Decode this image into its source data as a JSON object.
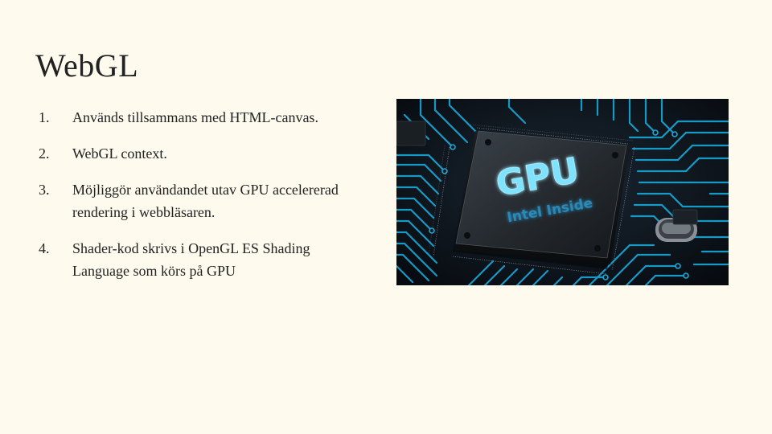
{
  "slide": {
    "title": "WebGL",
    "items": [
      {
        "number": "1.",
        "text": "Används tillsammans med HTML-canvas."
      },
      {
        "number": "2.",
        "text": "WebGL context."
      },
      {
        "number": "3.",
        "text": "Möjliggör användandet utav GPU accelererad rendering i webbläsaren."
      },
      {
        "number": "4.",
        "text": "Shader-kod skrivs i OpenGL ES Shading Language som körs på GPU"
      }
    ],
    "image": {
      "chip_label": "GPU",
      "chip_sublabel": "Intel Inside",
      "icon": "gpu-chip-photo"
    }
  },
  "colors": {
    "background": "#fefaee",
    "text": "#222222",
    "circuit": "#19a8d8",
    "chip_glow": "#7fe3ff"
  }
}
